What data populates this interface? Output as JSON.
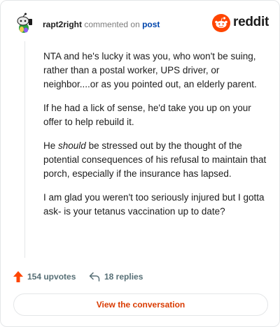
{
  "comment": {
    "username": "rapt2right",
    "action_text": "commented on",
    "post_link": "post",
    "brand_text": "reddit",
    "paragraphs": [
      "NTA and he's lucky it was you, who won't be suing, rather than a postal worker, UPS driver, or neighbor....or as you pointed out, an elderly parent.",
      "If he had a lick of sense, he'd take you up on your offer to help rebuild it.",
      null,
      "I am glad you weren't too seriously injured but I gotta ask- is your tetanus vaccination up to date?"
    ],
    "p3_before": "He ",
    "p3_em": "should",
    "p3_after": " be stressed out by the thought of the potential consequences of his refusal to maintain that porch, especially if the insurance has lapsed."
  },
  "footer": {
    "upvotes": "154 upvotes",
    "replies": "18 replies",
    "cta": "View the conversation"
  },
  "colors": {
    "accent": "#ff4500",
    "link": "#0045ac",
    "cta_text": "#d93a00",
    "muted": "#576f76"
  },
  "icons": [
    "snoo-avatar-icon",
    "reddit-logo-icon",
    "upvote-arrow-icon",
    "reply-arrow-icon"
  ]
}
